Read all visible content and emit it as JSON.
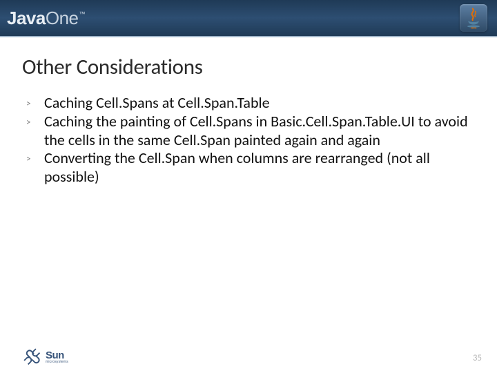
{
  "header": {
    "brand1": "Java",
    "brand2": "One",
    "tm": "™",
    "java_word": "Java"
  },
  "title": "Other Considerations",
  "bullets": [
    "Caching Cell.Spans at Cell.Span.Table",
    "Caching the painting of Cell.Spans in Basic.Cell.Span.Table.UI to avoid the cells in the same Cell.Span painted again and again",
    "Converting the Cell.Span when columns are rearranged (not all possible)"
  ],
  "footer": {
    "sun_big": "Sun",
    "sun_small": "microsystems",
    "page": "35"
  }
}
